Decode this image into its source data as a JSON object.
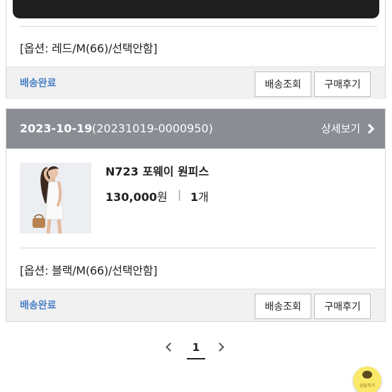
{
  "orders": [
    {
      "option": "[옵션: 레드/M(66)/선택안함]",
      "status": "배송완료",
      "track_label": "배송조회",
      "review_label": "구매후기"
    },
    {
      "date": "2023-10-19",
      "order_no": "(20231019-0000950)",
      "detail_label": "상세보기",
      "product_name": "N723 포웨이 원피스",
      "price": "130,000",
      "price_unit": "원",
      "separator": "|",
      "qty": "1",
      "qty_unit": "개",
      "option": "[옵션: 블랙/M(66)/선택안함]",
      "status": "배송완료",
      "track_label": "배송조회",
      "review_label": "구매후기"
    }
  ],
  "pagination": {
    "current": "1"
  },
  "chat": {
    "label": "상담하기"
  },
  "colors": {
    "status": "#4a80c8",
    "header": "#8a8d94",
    "chat": "#fbe96a"
  },
  "icons": {
    "prev": "chevron-left-icon",
    "next": "chevron-right-icon",
    "detail": "chevron-right-icon",
    "chat": "chat-icon"
  }
}
